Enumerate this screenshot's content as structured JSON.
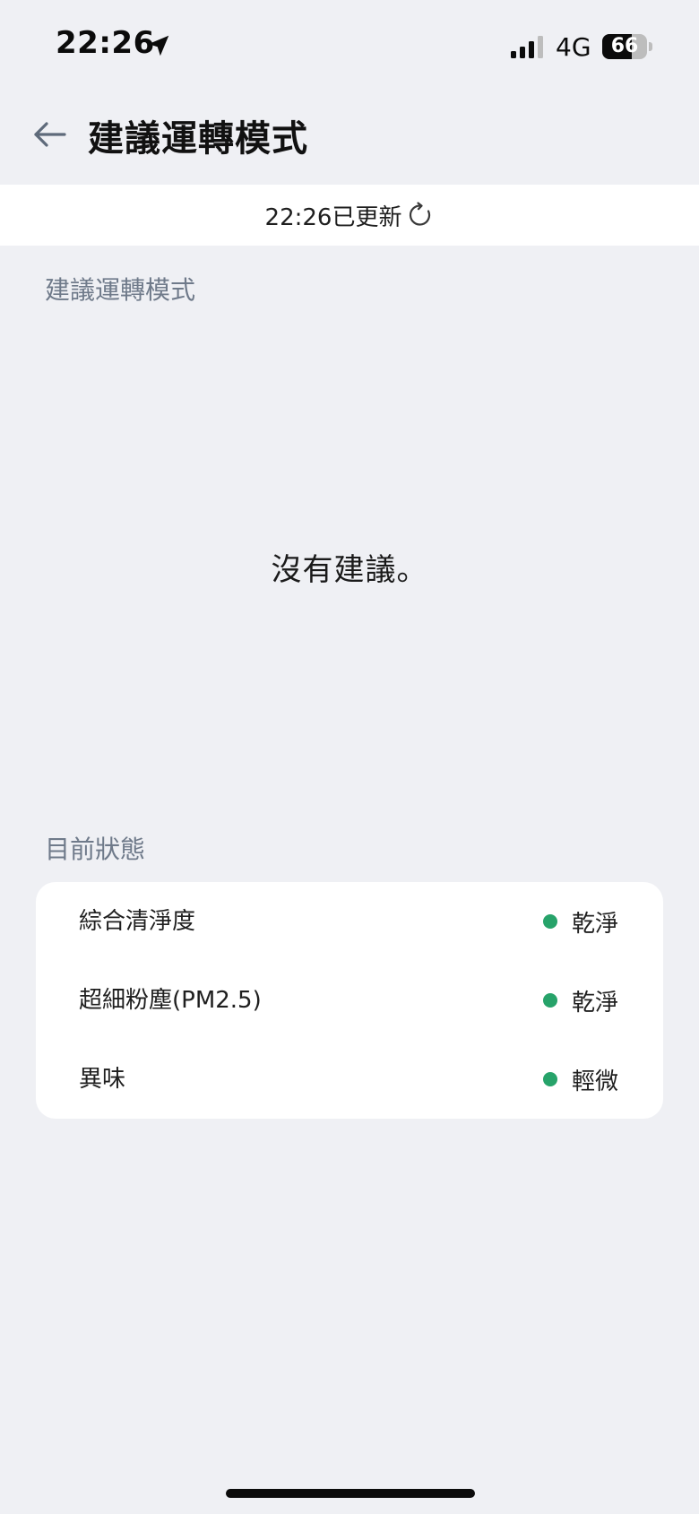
{
  "status_bar": {
    "time": "22:26",
    "network": "4G",
    "battery_percent": 66,
    "battery_label": "66",
    "icons": [
      "location-arrow-icon",
      "cellular-signal-icon",
      "battery-icon"
    ]
  },
  "header": {
    "title": "建議運轉模式",
    "back_icon": "arrow-left-icon"
  },
  "update_bar": {
    "text": "22:26已更新",
    "refresh_icon": "refresh-icon"
  },
  "suggestion_section": {
    "label": "建議運轉模式",
    "empty_message": "沒有建議。"
  },
  "status_section": {
    "label": "目前狀態",
    "rows": [
      {
        "label": "綜合清淨度",
        "value": "乾淨",
        "dot_color": "#27a36a"
      },
      {
        "label": "超細粉塵(PM2.5)",
        "value": "乾淨",
        "dot_color": "#27a36a"
      },
      {
        "label": "異味",
        "value": "輕微",
        "dot_color": "#27a36a"
      }
    ]
  },
  "colors": {
    "background": "#eff0f4",
    "card": "#ffffff",
    "section_label": "#6f7a8a",
    "status_good": "#27a36a"
  }
}
